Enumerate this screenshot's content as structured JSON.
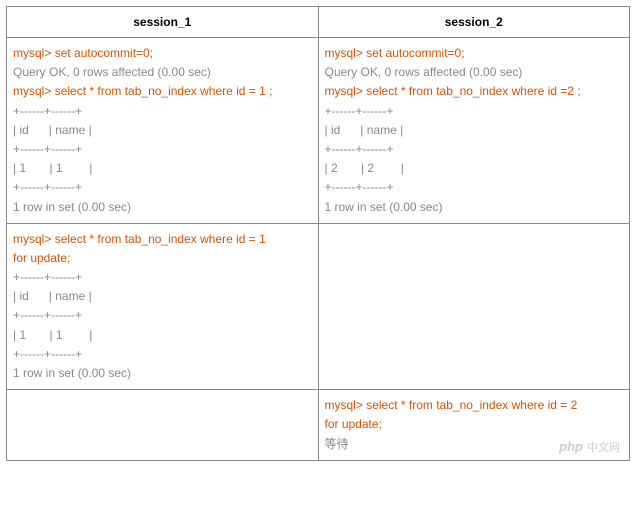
{
  "headers": {
    "col1": "session_1",
    "col2": "session_2"
  },
  "row1": {
    "s1": {
      "prompt": "mysql> ",
      "cmd1": "set autocommit=0;",
      "out1": "Query OK, 0 rows affected (0.00 sec)",
      "cmd2": "select * from tab_no_index where id = 1 ;",
      "border": "+------+------+",
      "head": "| id      | name |",
      "data": "| 1       | 1        |",
      "count": "1 row in set (0.00 sec)"
    },
    "s2": {
      "prompt": "mysql> ",
      "cmd1": "set autocommit=0;",
      "out1": "Query OK, 0 rows affected (0.00 sec)",
      "cmd2": "select * from tab_no_index where id =2 ;",
      "border": "+------+------+",
      "head": "| id      | name |",
      "data": "| 2       | 2        |",
      "count": "1 row in set (0.00 sec)"
    }
  },
  "row2": {
    "s1": {
      "prompt": "mysql> ",
      "cmd_l1": "select * from tab_no_index where id = 1",
      "cmd_l2": "for update;",
      "border": "+------+------+",
      "head": "| id      | name |",
      "data": "| 1       | 1        |",
      "count": "1 row in set (0.00 sec)"
    },
    "s2": {
      "empty": ""
    }
  },
  "row3": {
    "s1": {
      "empty": ""
    },
    "s2": {
      "prompt": "mysql> ",
      "cmd_l1": "select * from tab_no_index where id = 2",
      "cmd_l2": "for update;",
      "wait": "等待"
    }
  },
  "watermark": {
    "logo": "php",
    "text": "中文网"
  }
}
